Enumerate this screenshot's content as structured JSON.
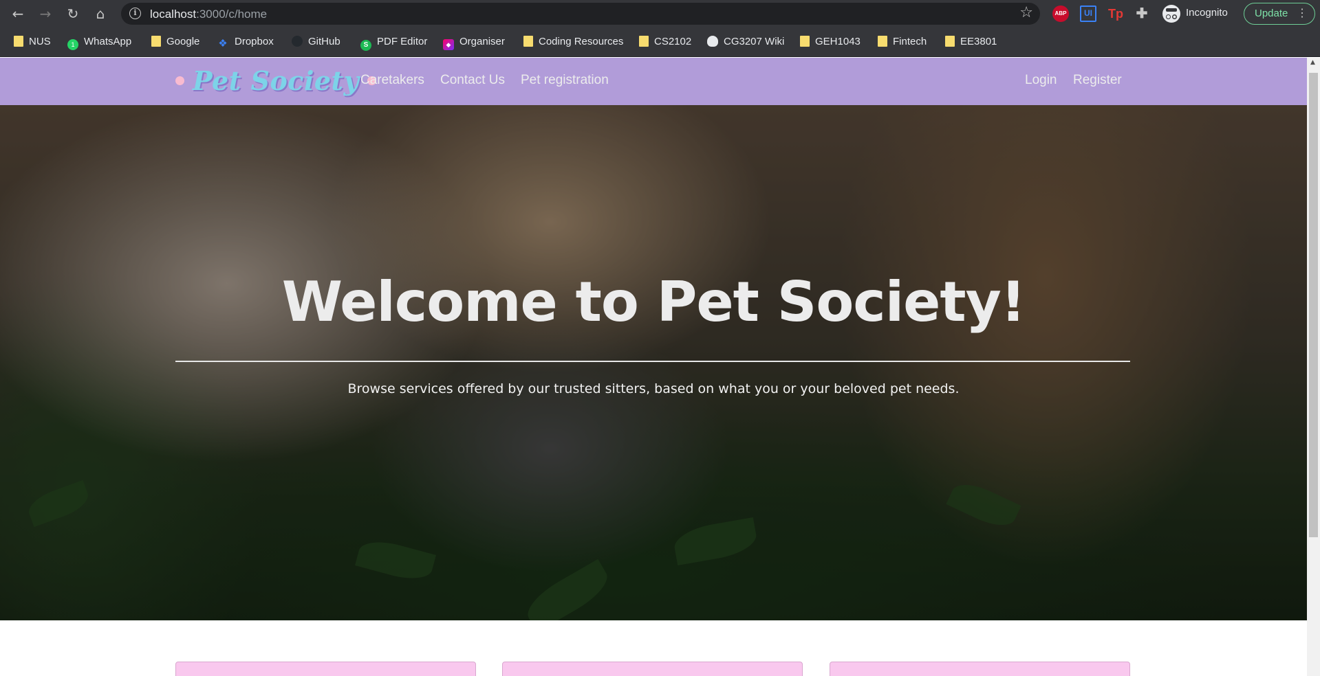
{
  "browser": {
    "url_host": "localhost",
    "url_path": ":3000/c/home",
    "profile_label": "Incognito",
    "update_label": "Update",
    "extensions": [
      "ABP",
      "UI",
      "Tp"
    ],
    "bookmarks": [
      "NUS",
      "WhatsApp",
      "Google",
      "Dropbox",
      "GitHub",
      "PDF Editor",
      "Organiser",
      "Coding Resources",
      "CS2102",
      "CG3207 Wiki",
      "GEH1043",
      "Fintech",
      "EE3801"
    ]
  },
  "navbar": {
    "brand": "Pet Society",
    "links": [
      "Caretakers",
      "Contact Us",
      "Pet registration"
    ],
    "auth": [
      "Login",
      "Register"
    ],
    "color": "#b19cd9"
  },
  "hero": {
    "title": "Welcome to Pet Society!",
    "subtitle": "Browse services offered by our trusted sitters, based on what you or your beloved pet needs."
  },
  "cards": {
    "color": "#f9c8ee",
    "count": 3
  }
}
